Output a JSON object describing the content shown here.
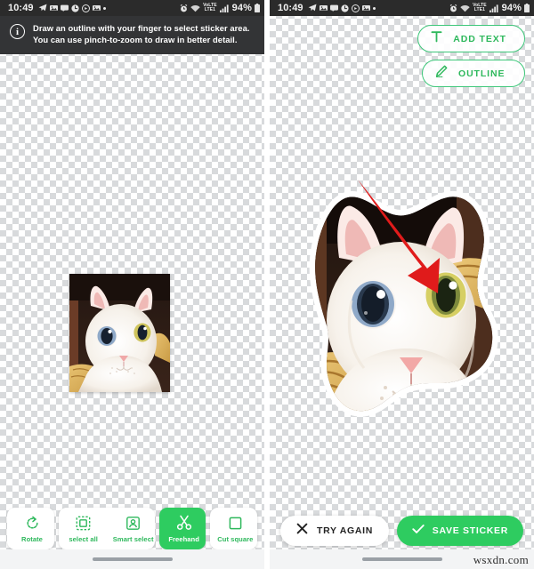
{
  "status_bar": {
    "time": "10:49",
    "battery_percent": "94%",
    "left_icons": [
      "telegram-icon",
      "image-icon",
      "message-icon",
      "clock-icon",
      "record-icon",
      "image-icon",
      "dot-icon"
    ],
    "right_icons": [
      "alarm-icon",
      "wifi-icon",
      "volte-signal-icon",
      "signal-bars-icon",
      "battery-icon"
    ],
    "network_label_top": "VoLTE",
    "network_label_bottom": "LTE1"
  },
  "left_screen": {
    "banner": {
      "icon": "info-icon",
      "line1": "Draw an outline with your finger to select sticker area.",
      "line2": "You can use pinch-to-zoom to draw in better detail."
    },
    "image_alt": "white-cat-photo",
    "toolbar": [
      {
        "id": "rotate",
        "label": "Rotate",
        "icon": "rotate-icon",
        "active": false
      },
      {
        "id": "select-all",
        "label": "select all",
        "icon": "select-all-icon",
        "active": false
      },
      {
        "id": "smart-select",
        "label": "Smart select",
        "icon": "smart-select-icon",
        "active": false
      },
      {
        "id": "freehand",
        "label": "Freehand",
        "icon": "scissors-icon",
        "active": true
      },
      {
        "id": "cut-square",
        "label": "Cut square",
        "icon": "square-icon",
        "active": false
      }
    ]
  },
  "right_screen": {
    "top_actions": [
      {
        "id": "add-text",
        "label": "ADD TEXT",
        "icon": "text-t-icon"
      },
      {
        "id": "outline",
        "label": "OUTLINE",
        "icon": "pencil-icon"
      }
    ],
    "sticker_alt": "cut-out-cat-sticker",
    "bottom_actions": [
      {
        "id": "try-again",
        "label": "TRY AGAIN",
        "icon": "close-x-icon",
        "style": "white"
      },
      {
        "id": "save-sticker",
        "label": "SAVE STICKER",
        "icon": "check-icon",
        "style": "green"
      }
    ],
    "annotation": {
      "type": "red-arrow",
      "points_to": "save-sticker"
    }
  },
  "watermark": "wsxdn.com",
  "colors": {
    "accent_green": "#2ecc60",
    "accent_green_text": "#2eb85c",
    "banner_bg": "#333436",
    "statusbar_bg": "#2b2b2b",
    "annotation_red": "#e01b1b"
  }
}
